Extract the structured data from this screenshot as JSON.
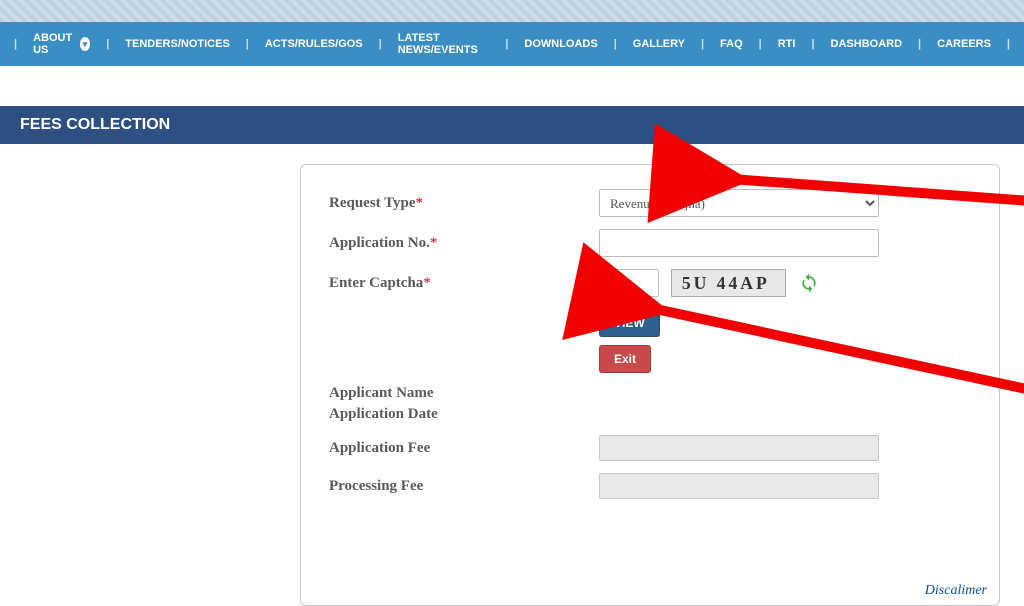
{
  "nav": {
    "items": [
      "ABOUT US",
      "TENDERS/NOTICES",
      "ACTS/RULES/GOS",
      "LATEST NEWS/EVENTS",
      "DOWNLOADS",
      "GALLERY",
      "FAQ",
      "RTI",
      "DASHBOARD",
      "CAREERS"
    ]
  },
  "titleBar": "FEES COLLECTION",
  "form": {
    "labels": {
      "requestType": "Request Type",
      "applicationNo": "Application No.",
      "enterCaptcha": "Enter Captcha",
      "applicantName": "Applicant Name",
      "applicationDate": "Application Date",
      "applicationFee": "Application Fee",
      "processingFee": "Processing Fee"
    },
    "values": {
      "requestType": "Revenue (Khajna)",
      "applicationNo": "",
      "captcha": ""
    },
    "captchaText": "5U 44AP",
    "buttons": {
      "view": "VIEW",
      "exit": "Exit"
    },
    "disclaimer": "Discalimer"
  }
}
